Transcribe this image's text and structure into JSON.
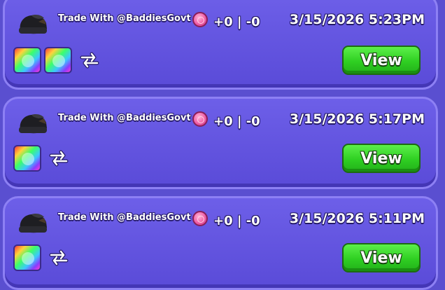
{
  "trades": [
    {
      "title": "Trade With @BaddiesGovt",
      "delta": "+0 | -0",
      "timestamp": "3/15/2026 5:23PM",
      "items": [
        "rainbow-item",
        "rainbow-item"
      ],
      "view_label": "View"
    },
    {
      "title": "Trade With @BaddiesGovt",
      "delta": "+0 | -0",
      "timestamp": "3/15/2026 5:17PM",
      "items": [
        "rainbow-item"
      ],
      "view_label": "View"
    },
    {
      "title": "Trade With @BaddiesGovt",
      "delta": "+0 | -0",
      "timestamp": "3/15/2026 5:11PM",
      "items": [
        "rainbow-item"
      ],
      "view_label": "View"
    }
  ],
  "icons": {
    "avatar": "avatar-icon",
    "currency": "coin-icon",
    "swap": "swap-arrows-icon"
  },
  "colors": {
    "card_bg": "#6d5fe8",
    "page_bg": "#5a4fd0",
    "view_button": "#2fcf22",
    "coin": "#f060a8"
  }
}
